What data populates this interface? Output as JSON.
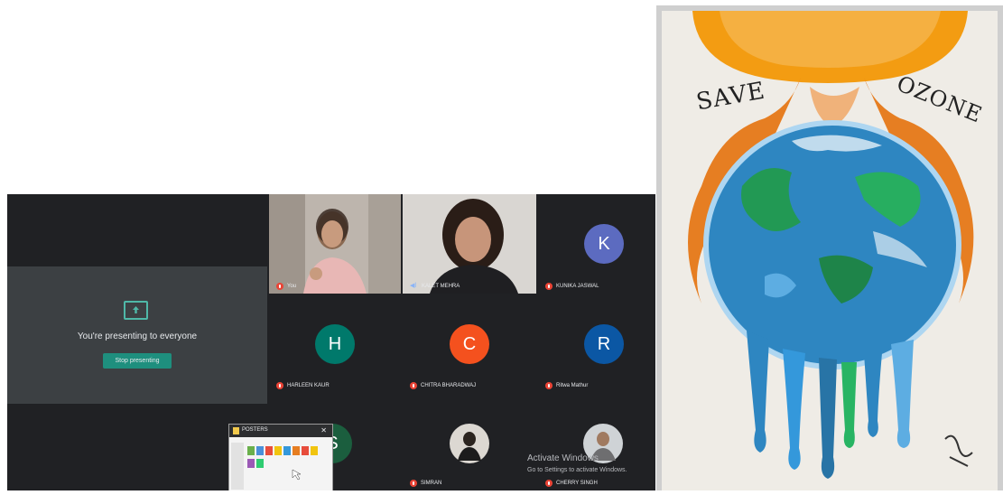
{
  "presenting": {
    "message": "You're presenting to everyone",
    "stop_button": "Stop presenting",
    "icon": "present-to-all-icon"
  },
  "participants": [
    {
      "name": "You",
      "type": "video",
      "mic": "muted"
    },
    {
      "name": "KALET MEHRA",
      "type": "video",
      "mic": "speaking"
    },
    {
      "name": "KUNIKA JASWAL",
      "initial": "K",
      "color": "#5c6bc0",
      "mic": "muted"
    },
    {
      "name": "HARLEEN KAUR",
      "initial": "H",
      "color": "#00796b",
      "mic": "muted"
    },
    {
      "name": "CHITRA BHARADWAJ",
      "initial": "C",
      "color": "#f4511e",
      "mic": "muted"
    },
    {
      "name": "Ritwa Mathur",
      "initial": "R",
      "color": "#0b57a4",
      "mic": "muted"
    },
    {
      "name": "",
      "initial": "S",
      "color": "#1b5e3e",
      "mic": "muted"
    },
    {
      "name": "SIMRAN",
      "type": "photo",
      "mic": "muted"
    },
    {
      "name": "CHERRY SINGH",
      "type": "photo",
      "mic": "muted"
    }
  ],
  "popup": {
    "title": "POSTERS",
    "close": "✕"
  },
  "watermark": {
    "line1": "Activate Windows",
    "line2": "Go to Settings to activate Windows."
  },
  "poster": {
    "text_left": "SAVE",
    "text_right": "OZONE"
  }
}
